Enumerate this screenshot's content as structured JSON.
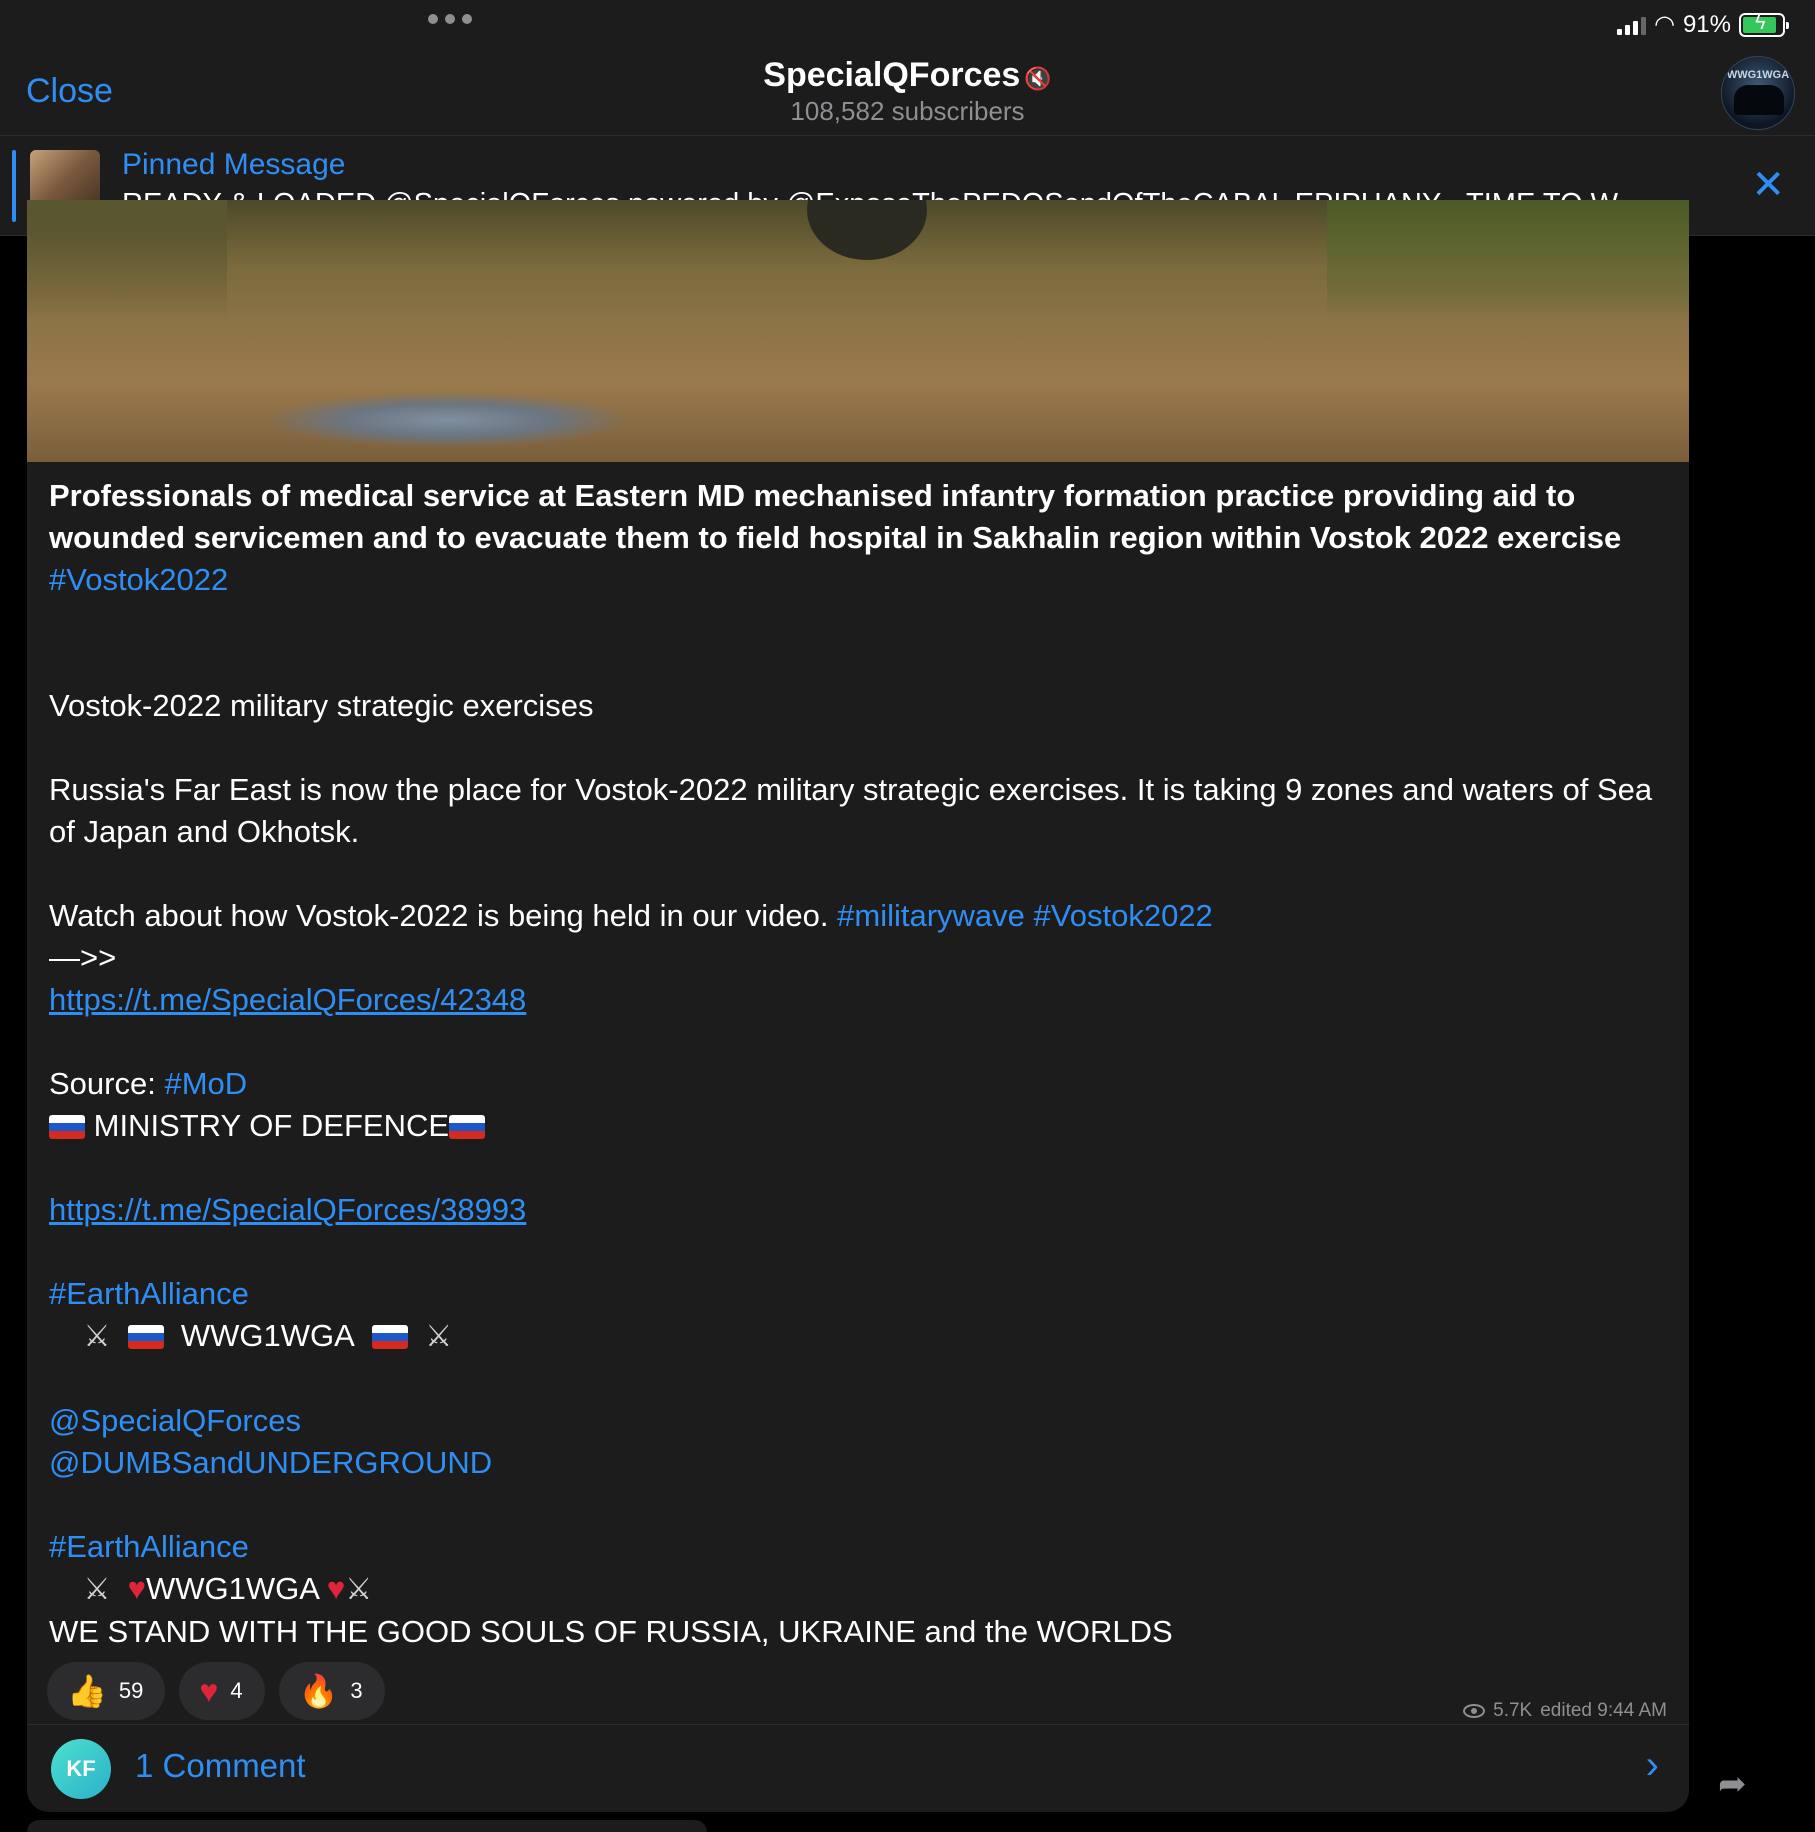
{
  "status_bar": {
    "battery": "91%"
  },
  "header": {
    "close_label": "Close",
    "channel_name": "SpecialQForces",
    "subscribers": "108,582 subscribers",
    "avatar_text": "WWG1WGA"
  },
  "pinned": {
    "title": "Pinned Message",
    "text": "READY & LOADED    @SpecialQForces  powered by  @ExposeThePEDOSendOfTheCABAL    EPIPHANY -   TIME TO W..."
  },
  "message": {
    "headline": "Professionals of medical service at Eastern MD mechanised infantry formation practice providing aid to wounded servicemen and to evacuate them to field hospital in Sakhalin region within Vostok 2022 exercise",
    "hashtag1": "#Vostok2022",
    "exercises_title": "Vostok-2022 military strategic exercises",
    "paragraph1": "Russia's Far East is now the place for Vostok-2022 military strategic exercises. It is taking 9 zones and waters of Sea of Japan and Okhotsk.",
    "watch_text": "Watch about how Vostok-2022 is being held in our video. ",
    "hashtag_military": "#militarywave",
    "hashtag_vostok": "#Vostok2022",
    "arrow": "—>>",
    "url1": "https://t.me/SpecialQForces/42348",
    "source_label": "Source: ",
    "hashtag_mod": "#MoD",
    "ministry": "MINISTRY OF DEFENCE",
    "url2": "https://t.me/SpecialQForces/38993",
    "hashtag_earth1": "#EarthAlliance",
    "wwg1": "WWG1WGA",
    "mention1": "@SpecialQForces",
    "mention2": "@DUMBSandUNDERGROUND",
    "hashtag_earth2": "#EarthAlliance",
    "wwg2": "WWG1WGA",
    "closing": "WE STAND WITH THE GOOD SOULS OF RUSSIA, UKRAINE and the WORLDS"
  },
  "reactions": [
    {
      "emoji": "👍",
      "count": "59"
    },
    {
      "emoji": "♥",
      "count": "4"
    },
    {
      "emoji": "🔥",
      "count": "3"
    }
  ],
  "meta": {
    "views": "5.7K",
    "edited": "edited 9:44 AM"
  },
  "comments": {
    "initials": "KF",
    "label": "1 Comment"
  },
  "colors": {
    "accent": "#2f8ef4",
    "bubble": "#1c1c1d",
    "background": "#000000"
  }
}
